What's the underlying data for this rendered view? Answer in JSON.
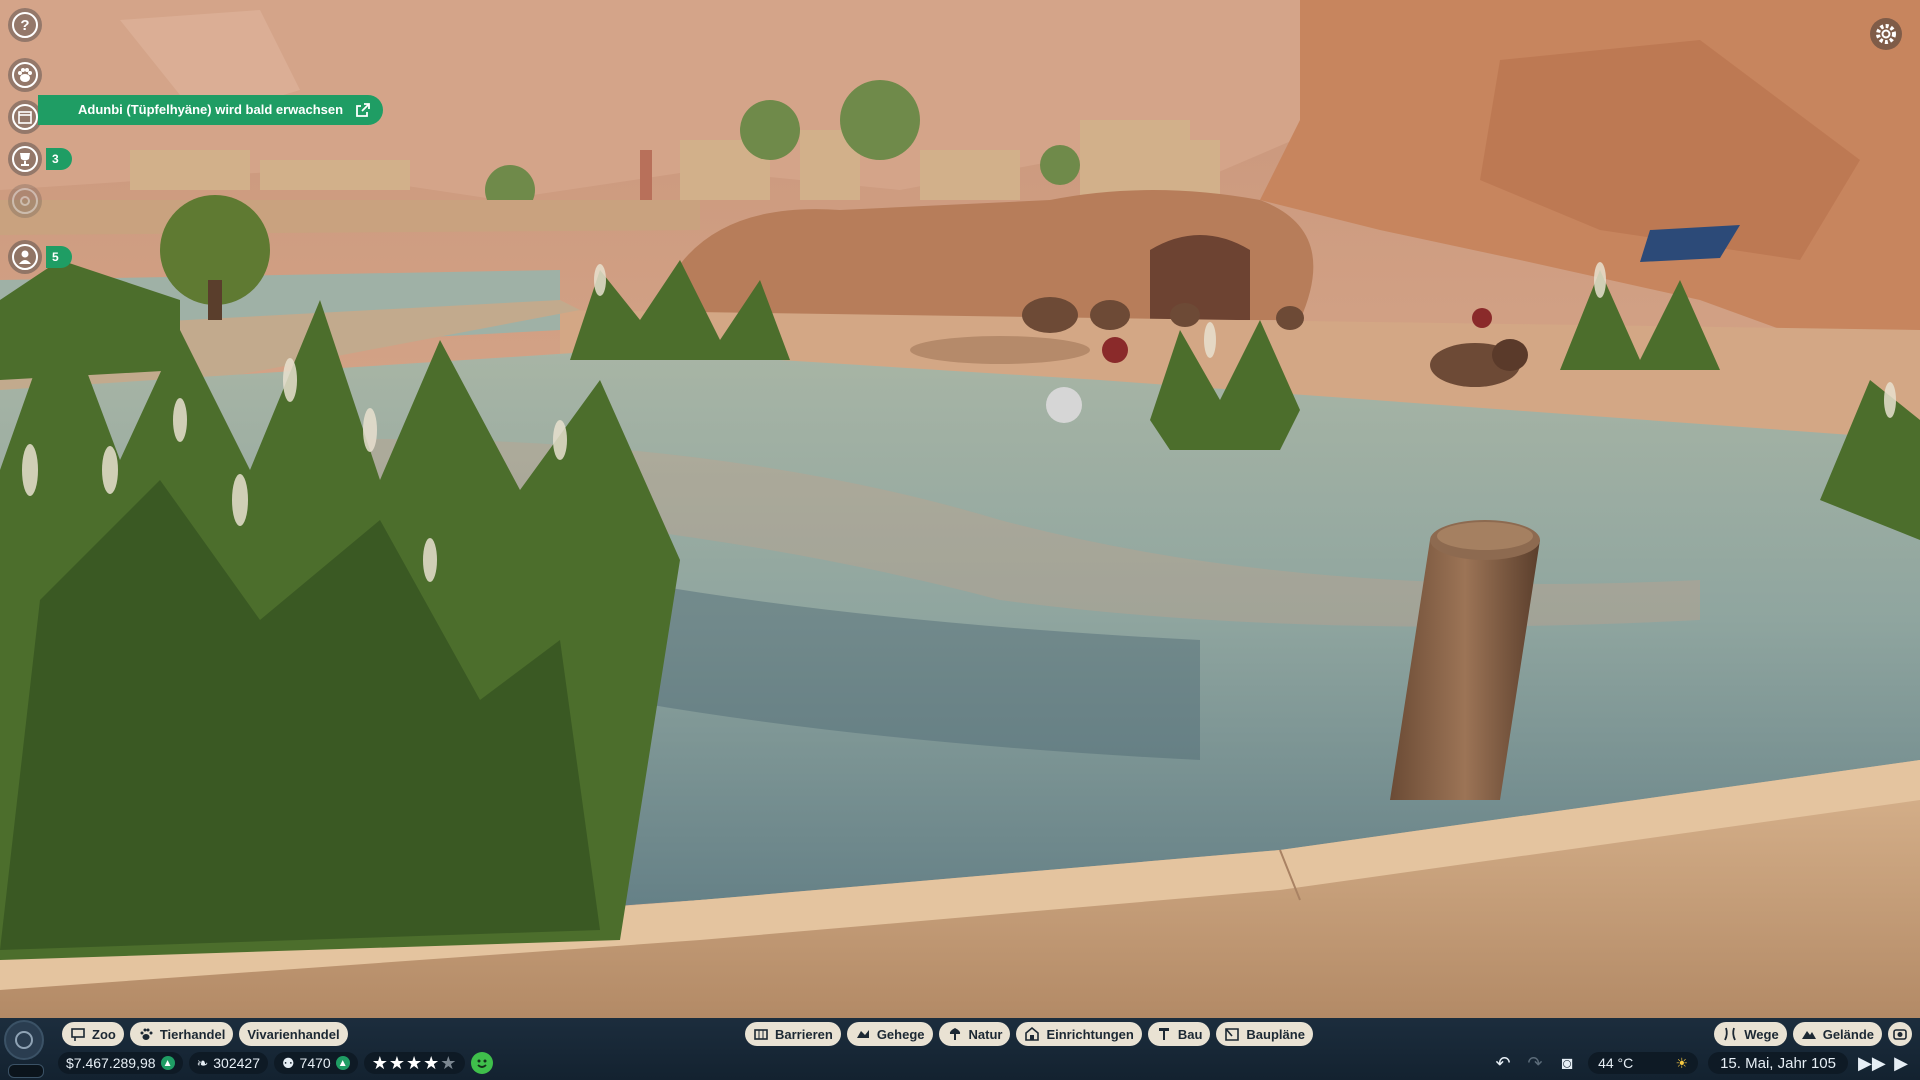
{
  "notification": {
    "text": "Adunbi (Tüpfelhyäne) wird bald erwachsen"
  },
  "left_toolbar": {
    "research_badge": "3",
    "staff_badge": "5"
  },
  "bottom_bar": {
    "left_tabs": [
      {
        "label": "Zoo",
        "icon": "zoo-sign-icon"
      },
      {
        "label": "Tierhandel",
        "icon": "paw-icon"
      },
      {
        "label": "Vivarienhandel",
        "icon": ""
      }
    ],
    "center_tabs": [
      {
        "label": "Barrieren",
        "icon": "fence-icon"
      },
      {
        "label": "Gehege",
        "icon": "habitat-icon"
      },
      {
        "label": "Natur",
        "icon": "tree-icon"
      },
      {
        "label": "Einrichtungen",
        "icon": "building-icon"
      },
      {
        "label": "Bau",
        "icon": "construction-icon"
      },
      {
        "label": "Baupläne",
        "icon": "blueprint-icon"
      }
    ],
    "right_tabs": [
      {
        "label": "Wege",
        "icon": "path-icon"
      },
      {
        "label": "Gelände",
        "icon": "terrain-icon"
      }
    ],
    "money": "$7.467.289,98",
    "conservation_credits": "302427",
    "guests": "7470",
    "rating_stars": 4,
    "temperature": "44 °C",
    "date": "15. Mai, Jahr 105"
  },
  "colors": {
    "accent_green": "#1f9d64",
    "bar_bg": "#1c2d3d",
    "tab_bg": "#e9e2d3"
  }
}
